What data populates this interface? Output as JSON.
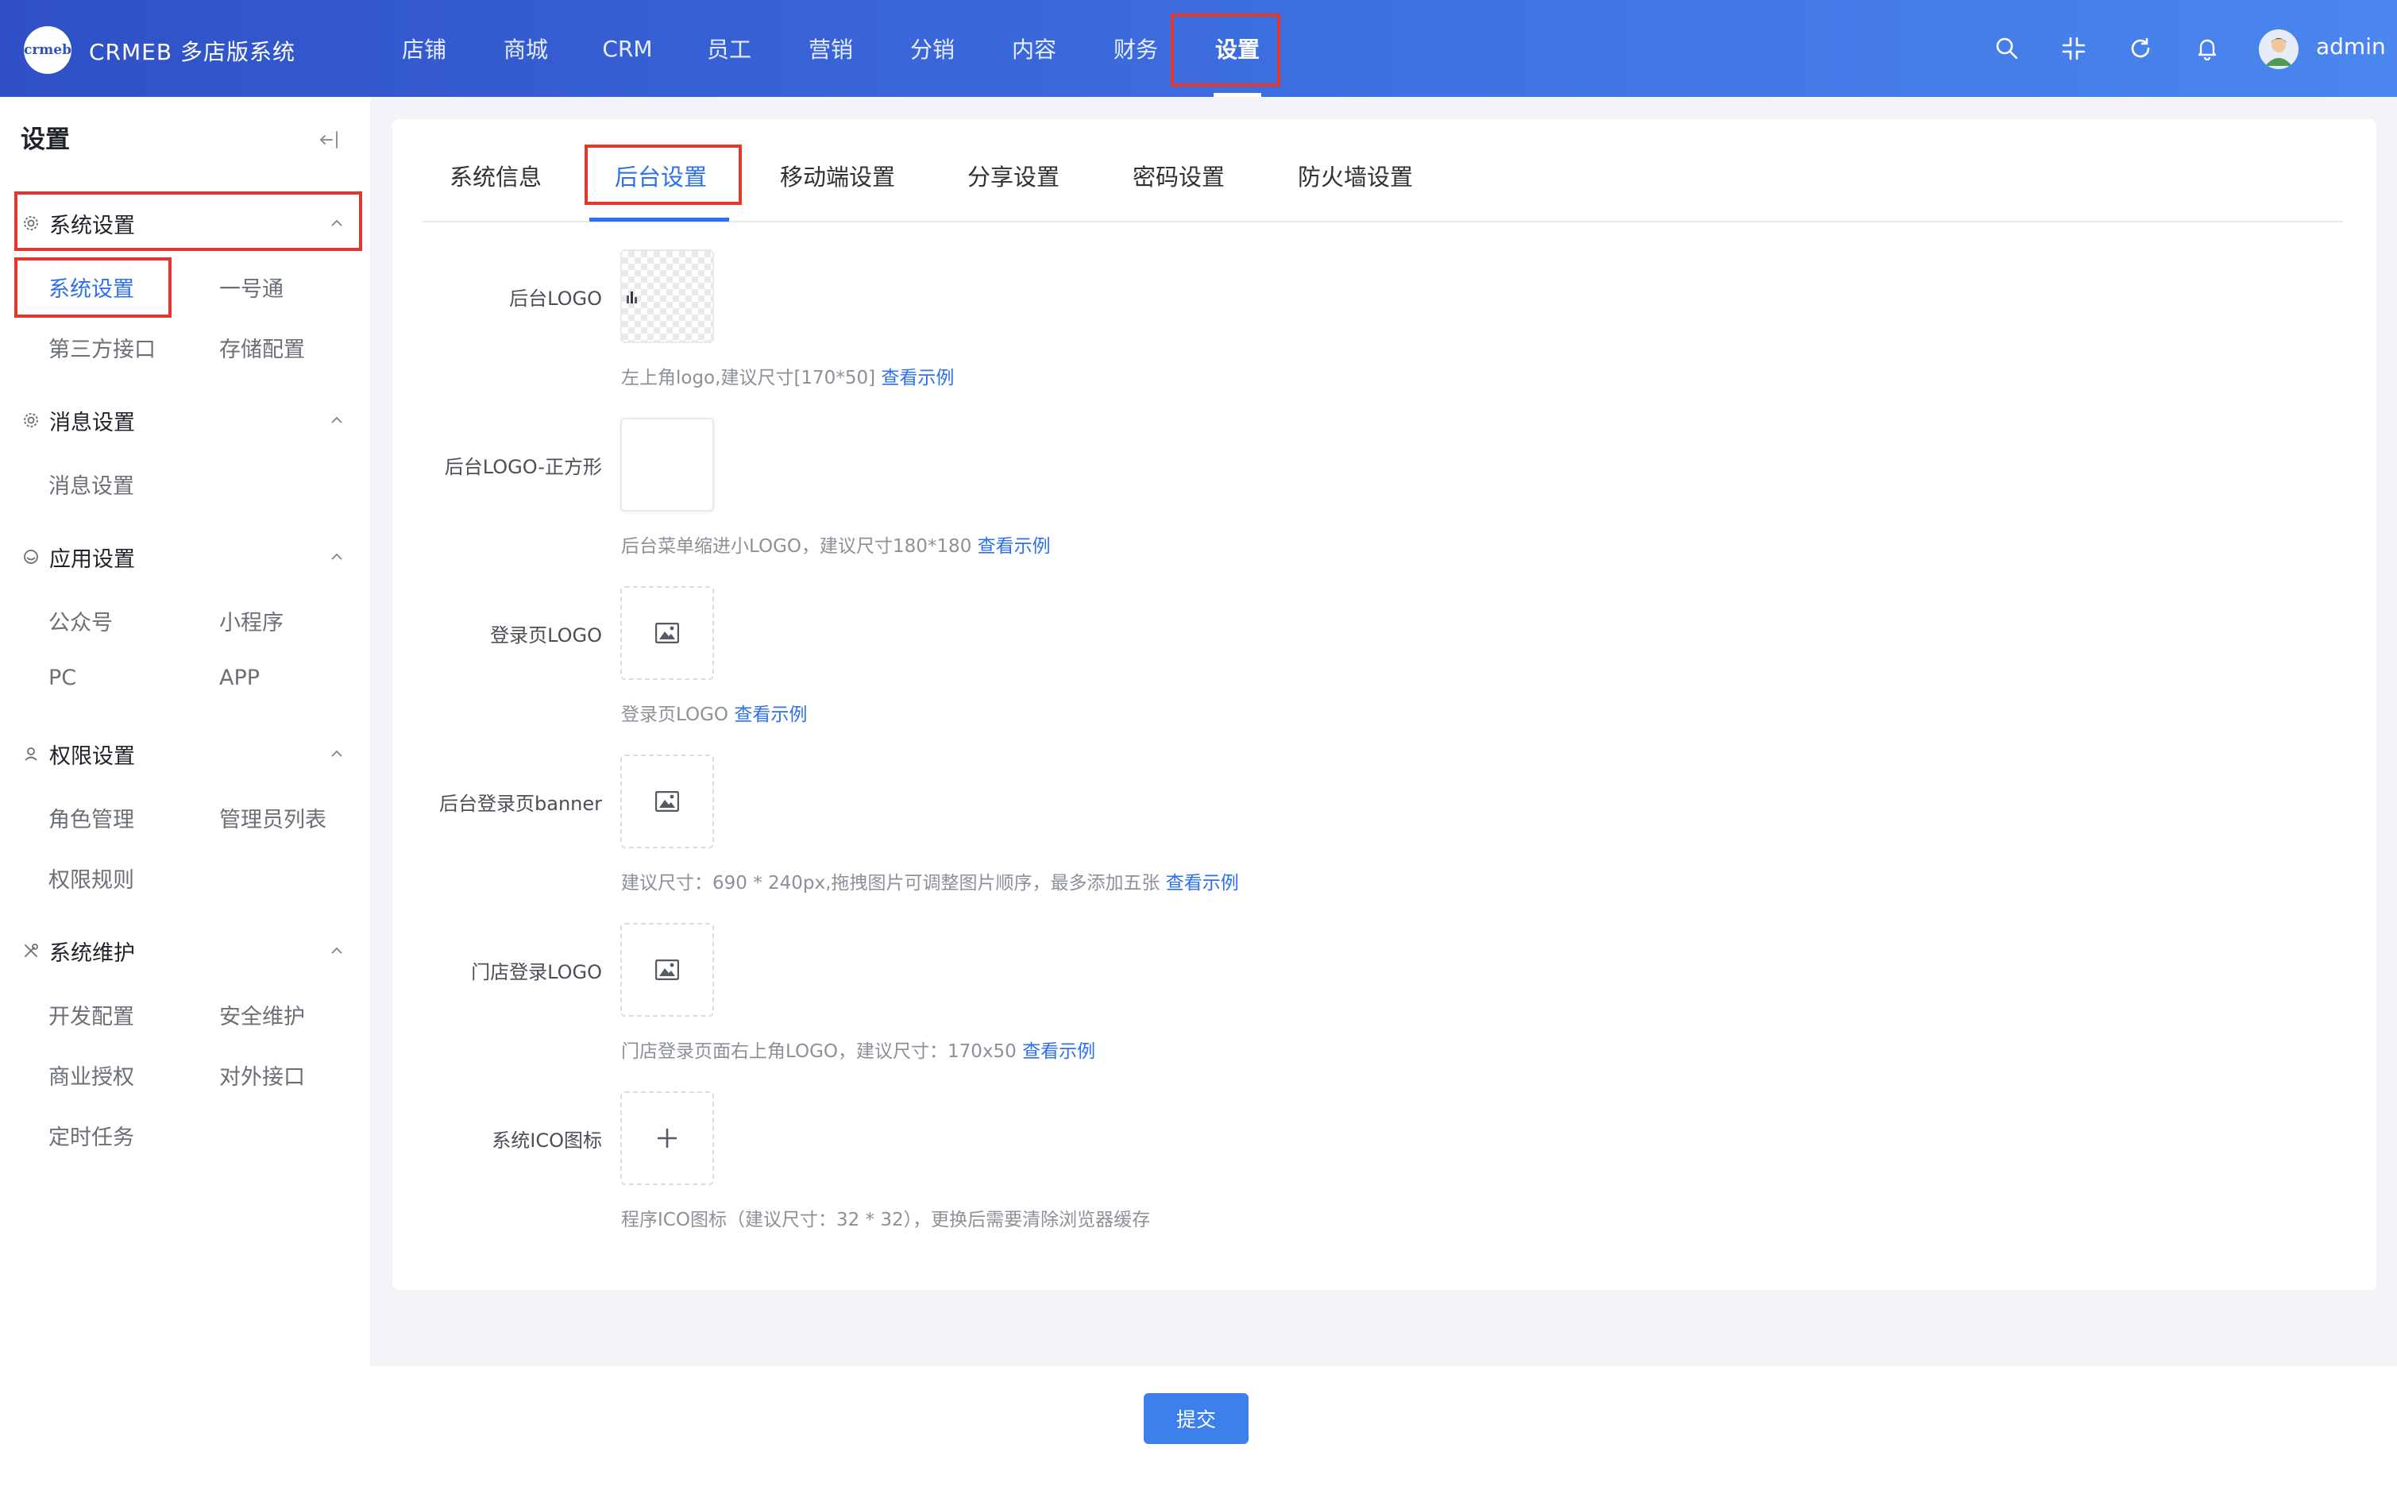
{
  "header": {
    "logo_text": "crmeb",
    "app_title": "CRMEB 多店版系统",
    "nav": [
      "店铺",
      "商城",
      "CRM",
      "员工",
      "营销",
      "分销",
      "内容",
      "财务",
      "设置"
    ],
    "active_nav": "设置",
    "username": "admin"
  },
  "sidebar": {
    "title": "设置",
    "groups": [
      {
        "label": "系统设置",
        "items": [
          "系统设置",
          "一号通",
          "第三方接口",
          "存储配置"
        ]
      },
      {
        "label": "消息设置",
        "items": [
          "消息设置"
        ]
      },
      {
        "label": "应用设置",
        "items": [
          "公众号",
          "小程序",
          "PC",
          "APP"
        ]
      },
      {
        "label": "权限设置",
        "items": [
          "角色管理",
          "管理员列表",
          "权限规则"
        ]
      },
      {
        "label": "系统维护",
        "items": [
          "开发配置",
          "安全维护",
          "商业授权",
          "对外接口",
          "定时任务"
        ]
      }
    ]
  },
  "tabs": [
    "系统信息",
    "后台设置",
    "移动端设置",
    "分享设置",
    "密码设置",
    "防火墙设置"
  ],
  "active_tab": "后台设置",
  "fields": [
    {
      "label": "后台LOGO",
      "hint": "左上角logo,建议尺寸[170*50]",
      "link": "查看示例"
    },
    {
      "label": "后台LOGO-正方形",
      "hint": "后台菜单缩进小LOGO，建议尺寸180*180",
      "link": "查看示例"
    },
    {
      "label": "登录页LOGO",
      "hint": "登录页LOGO",
      "link": "查看示例"
    },
    {
      "label": "后台登录页banner",
      "hint": "建议尺寸：690 * 240px,拖拽图片可调整图片顺序，最多添加五张",
      "link": "查看示例"
    },
    {
      "label": "门店登录LOGO",
      "hint": "门店登录页面右上角LOGO，建议尺寸：170x50",
      "link": "查看示例"
    },
    {
      "label": "系统ICO图标",
      "hint": "程序ICO图标（建议尺寸：32 * 32），更换后需要清除浏览器缓存",
      "link": ""
    }
  ],
  "submit_label": "提交",
  "colors": {
    "accent": "#2d6ff0",
    "highlight": "#e0382c",
    "header_start": "#2f50c6",
    "header_end": "#4a86ee"
  }
}
